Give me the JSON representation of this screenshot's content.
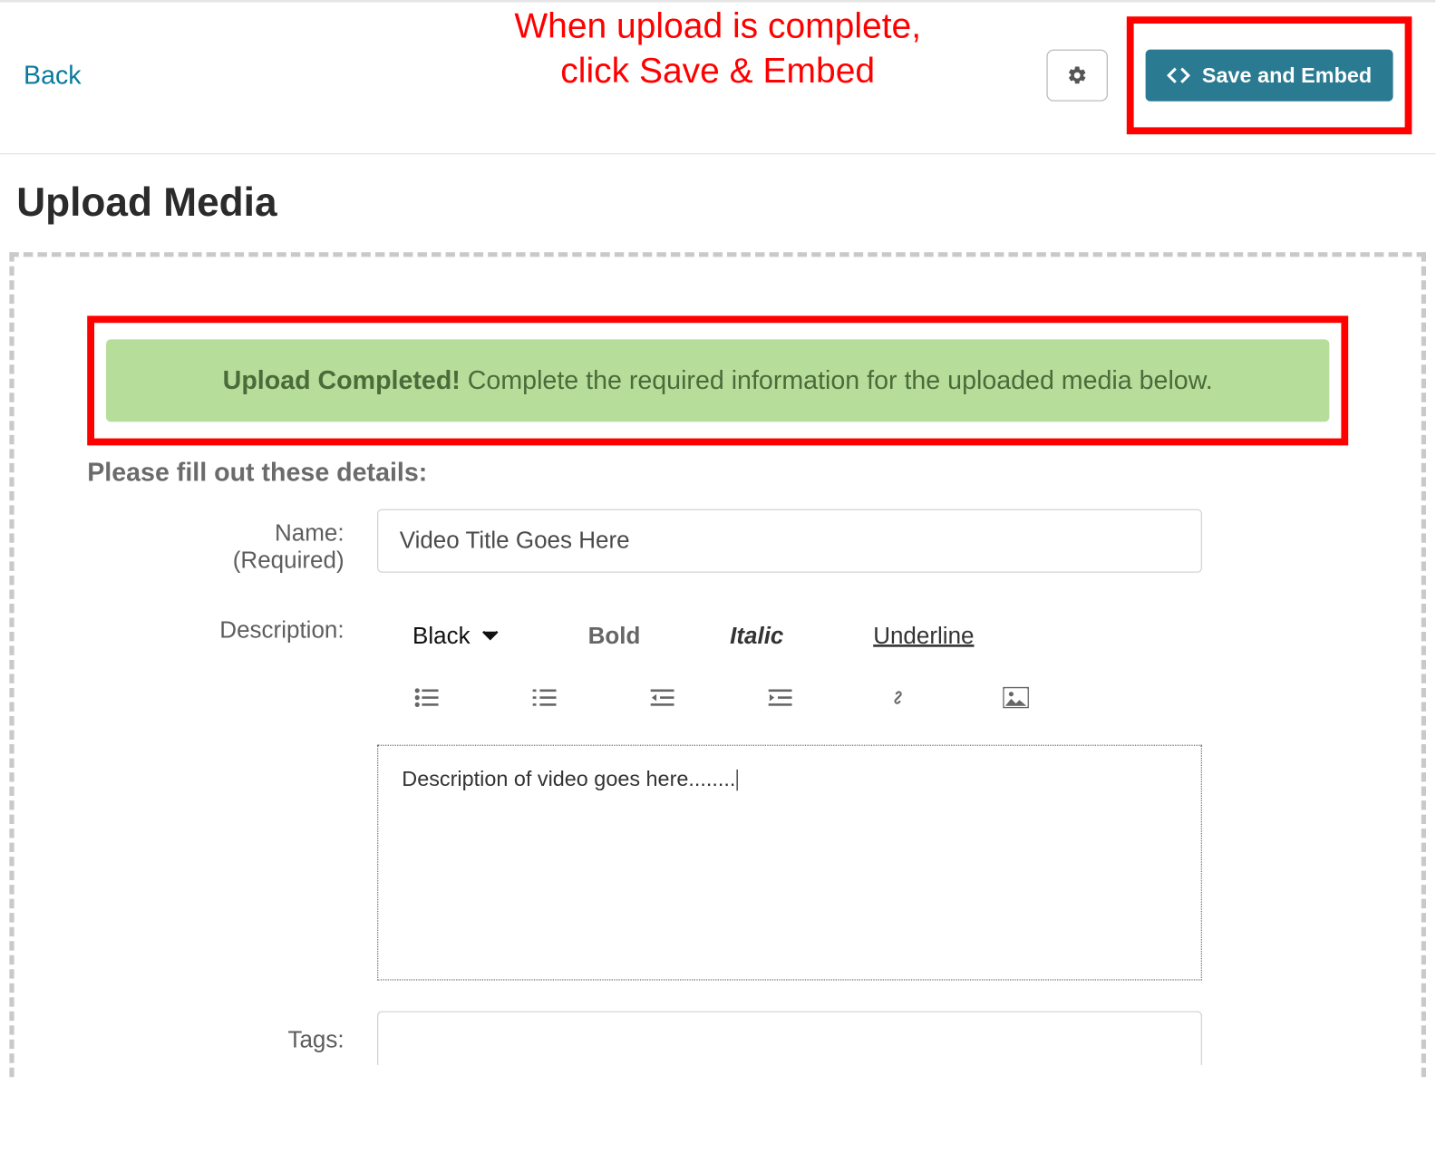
{
  "topbar": {
    "back_label": "Back",
    "save_label": "Save and Embed"
  },
  "annotation": {
    "line1": "When upload is complete,",
    "line2": "click Save & Embed"
  },
  "page_title": "Upload Media",
  "alert": {
    "strong": "Upload Completed!",
    "text": " Complete the required information for the uploaded media below."
  },
  "details_heading": "Please fill out these details:",
  "form": {
    "name_label": "Name:",
    "name_required": "(Required)",
    "name_value": "Video Title Goes Here",
    "description_label": "Description:",
    "description_value": "Description of video goes here........",
    "tags_label": "Tags:",
    "tags_value": ""
  },
  "rte": {
    "color_label": "Black",
    "bold_label": "Bold",
    "italic_label": "Italic",
    "underline_label": "Underline"
  }
}
